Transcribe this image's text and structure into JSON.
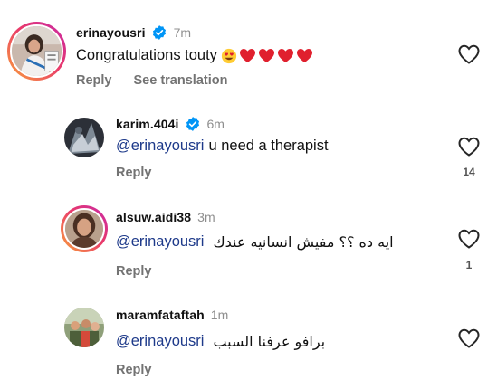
{
  "colors": {
    "verified": "#0095f6",
    "mention": "#1e3a8a",
    "muted": "#737373",
    "heart_emoji": "#e0202e"
  },
  "comments": [
    {
      "username": "erinayousri",
      "verified": true,
      "time": "7m",
      "text": "Congratulations touty",
      "emoji": [
        "smiling-face-with-heart-eyes",
        "red-heart",
        "red-heart",
        "red-heart",
        "red-heart"
      ],
      "actions": {
        "reply": "Reply",
        "translate": "See translation"
      },
      "likes": ""
    },
    {
      "username": "karim.404i",
      "verified": true,
      "time": "6m",
      "mention": "@erinayousri",
      "text": "u need a therapist",
      "actions": {
        "reply": "Reply"
      },
      "likes": "14"
    },
    {
      "username": "alsuw.aidi38",
      "verified": false,
      "time": "3m",
      "mention": "@erinayousri",
      "text": "ايه ده ؟؟ مفيش انسانيه عندك",
      "actions": {
        "reply": "Reply"
      },
      "likes": "1"
    },
    {
      "username": "maramfataftah",
      "verified": false,
      "time": "1m",
      "mention": "@erinayousri",
      "text": "برافو عرفنا السبب",
      "actions": {
        "reply": "Reply"
      },
      "likes": ""
    }
  ]
}
